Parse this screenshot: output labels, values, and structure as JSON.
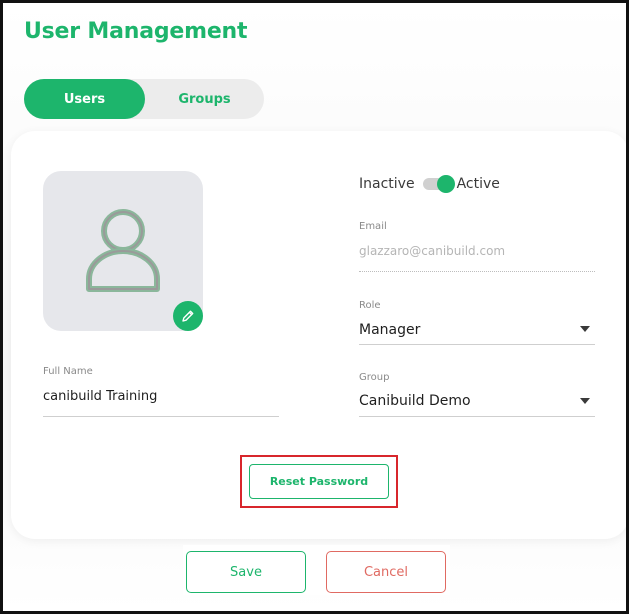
{
  "page": {
    "title": "User Management"
  },
  "tabs": [
    {
      "label": "Users",
      "active": true
    },
    {
      "label": "Groups",
      "active": false
    }
  ],
  "avatar": {
    "icon": "user-placeholder-icon",
    "edit_icon": "pencil-icon"
  },
  "status": {
    "inactive_label": "Inactive",
    "active_label": "Active",
    "is_active": true
  },
  "form": {
    "full_name": {
      "label": "Full Name",
      "value": "canibuild Training"
    },
    "email": {
      "label": "Email",
      "placeholder": "glazzaro@canibuild.com"
    },
    "role": {
      "label": "Role",
      "value": "Manager"
    },
    "group": {
      "label": "Group",
      "value": "Canibuild Demo"
    }
  },
  "actions": {
    "reset_password": "Reset Password",
    "save": "Save",
    "cancel": "Cancel"
  },
  "colors": {
    "accent": "#1db56c",
    "cancel": "#e06a62",
    "highlight": "#d8262c"
  }
}
